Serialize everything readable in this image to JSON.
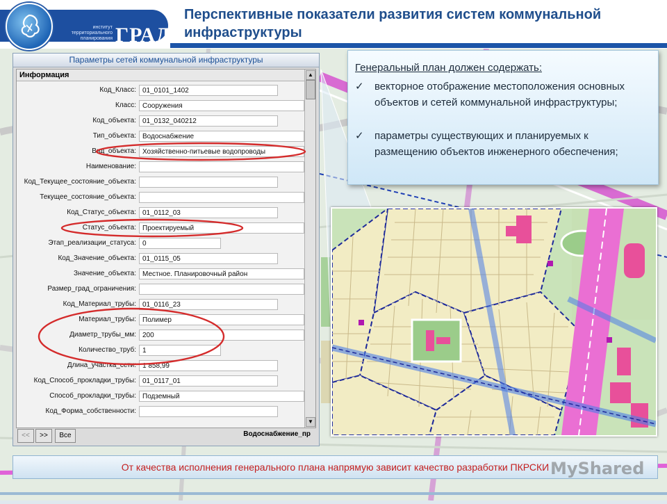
{
  "header": {
    "logo_subtitle": "институт территориального планирования",
    "logo_name": "ГРАД",
    "title": "Перспективные показатели развития систем коммунальной инфраструктуры"
  },
  "info_window": {
    "title": "Параметры сетей коммунальной инфраструктуры",
    "panel_title": "Информация",
    "fields": [
      {
        "label": "Код_Класс:",
        "value": "01_0101_1402"
      },
      {
        "label": "Класс:",
        "value": "Сооружения"
      },
      {
        "label": "Код_объекта:",
        "value": "01_0132_040212"
      },
      {
        "label": "Тип_объекта:",
        "value": "Водоснабжение"
      },
      {
        "label": "Вид_объекта:",
        "value": "Хозяйственно-питьевые водопроводы"
      },
      {
        "label": "Наименование:",
        "value": ""
      },
      {
        "label": "Код_Текущее_состояние_объекта:",
        "value": ""
      },
      {
        "label": "Текущее_состояние_объекта:",
        "value": ""
      },
      {
        "label": "Код_Статус_объекта:",
        "value": "01_0112_03"
      },
      {
        "label": "Статус_объекта:",
        "value": "Проектируемый"
      },
      {
        "label": "Этап_реализации_статуса:",
        "value": "0"
      },
      {
        "label": "Код_Значение_объекта:",
        "value": "01_0115_05"
      },
      {
        "label": "Значение_объекта:",
        "value": "Местное. Планировочный район"
      },
      {
        "label": "Размер_град_ограничения:",
        "value": ""
      },
      {
        "label": "Код_Материал_трубы:",
        "value": "01_0116_23"
      },
      {
        "label": "Материал_трубы:",
        "value": "Полимер"
      },
      {
        "label": "Диаметр_трубы_мм:",
        "value": "200"
      },
      {
        "label": "Количество_труб:",
        "value": "1"
      },
      {
        "label": "Длина_участка_сети:",
        "value": "1 858,99"
      },
      {
        "label": "Код_Способ_прокладки_трубы:",
        "value": "01_0117_01"
      },
      {
        "label": "Способ_прокладки_трубы:",
        "value": "Подземный"
      },
      {
        "label": "Код_Форма_собственности:",
        "value": ""
      }
    ],
    "nav": {
      "prev_label": "<<",
      "next_label": ">>",
      "all_label": "Все",
      "status": "Водоснабжение_пр"
    }
  },
  "callout": {
    "heading": "Генеральный план должен содержать:",
    "check_glyph": "✓",
    "items": [
      "векторное отображение местоположения основных объектов и сетей коммунальной инфраструктуры;",
      "параметры существующих и планируемых к размещению объектов инженерного обеспечения;"
    ]
  },
  "footer": {
    "text": "От качества исполнения генерального плана напрямую зависит качество разработки ПКРСКИ",
    "watermark": "MyShared"
  },
  "colors": {
    "title_blue": "#1f4e8c",
    "brand_blue": "#1d4fa0",
    "highlight_red": "#d42b2b",
    "footer_red": "#c42020"
  }
}
